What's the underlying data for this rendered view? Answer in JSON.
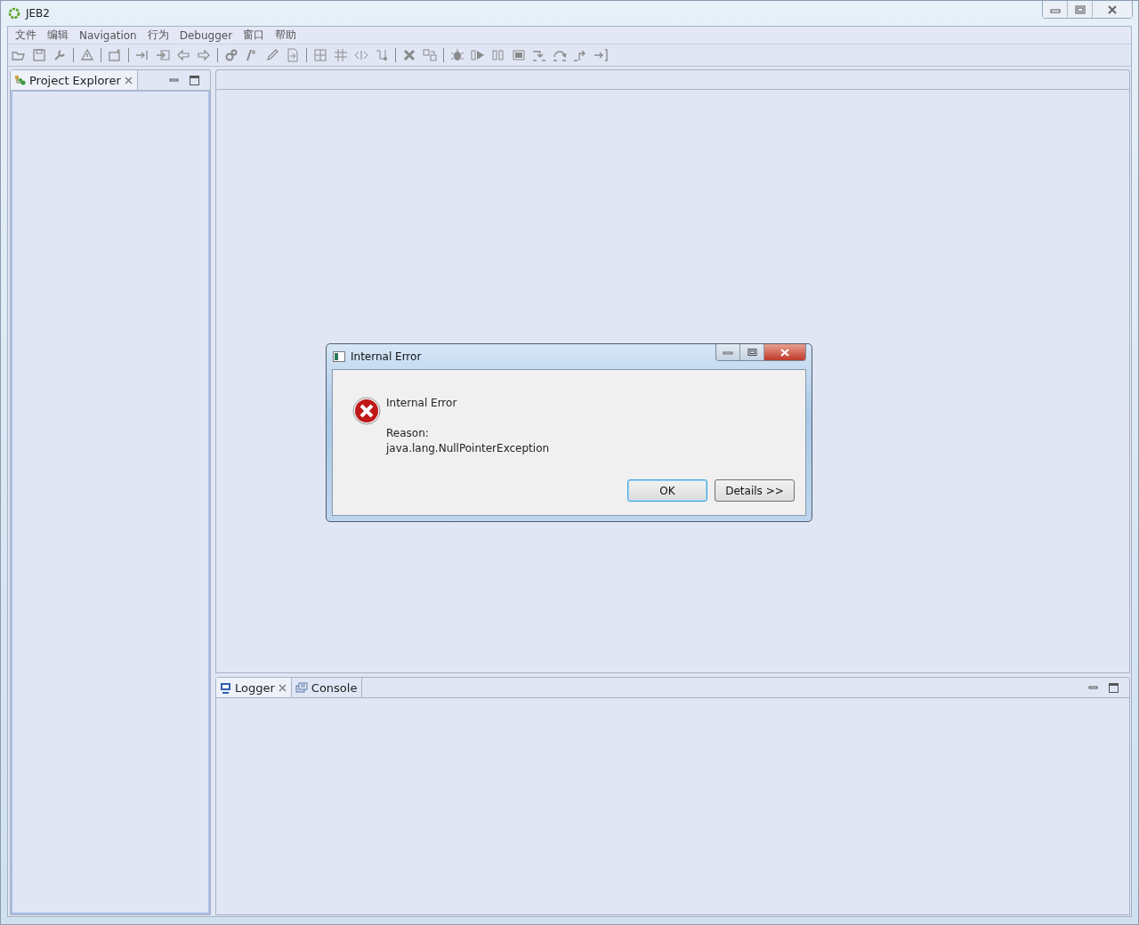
{
  "window": {
    "title": "JEB2"
  },
  "menu": [
    "文件",
    "编辑",
    "Navigation",
    "行为",
    "Debugger",
    "窗口",
    "帮助"
  ],
  "project_explorer": {
    "tabs": [
      {
        "label": "Project Explorer",
        "selected": true
      }
    ]
  },
  "bottom_panel": {
    "tabs": [
      {
        "label": "Logger",
        "selected": true
      },
      {
        "label": "Console",
        "selected": false
      }
    ]
  },
  "dialog": {
    "title": "Internal Error",
    "heading": "Internal Error",
    "reason_label": "Reason:",
    "reason": "java.lang.NullPointerException",
    "buttons": [
      {
        "label": "OK",
        "kind": "default"
      },
      {
        "label": "Details >>",
        "kind": "normal"
      }
    ]
  }
}
